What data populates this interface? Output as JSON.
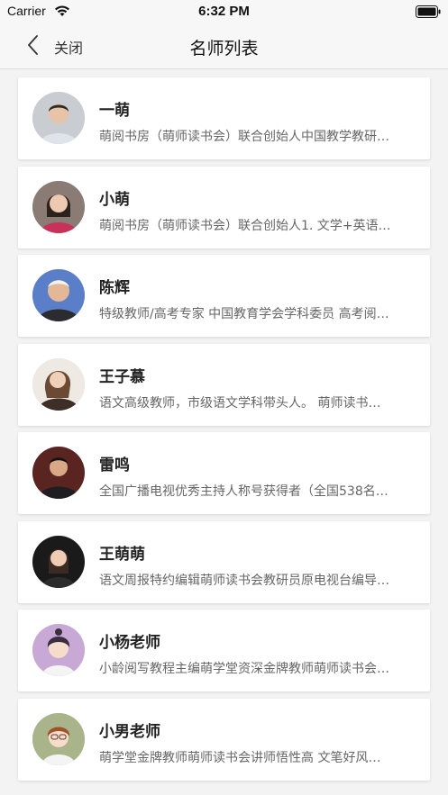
{
  "status_bar": {
    "carrier": "Carrier",
    "time": "6:32 PM"
  },
  "nav": {
    "back_label": "关闭",
    "title": "名师列表"
  },
  "teachers": [
    {
      "name": "一萌",
      "desc": "萌阅书房（萌师读书会）联合创始人中国教学教研…"
    },
    {
      "name": "小萌",
      "desc": "萌阅书房（萌师读书会）联合创始人1. 文学+英语…"
    },
    {
      "name": "陈辉",
      "desc": "特级教师/高考专家 中国教育学会学科委员 高考阅…"
    },
    {
      "name": "王子慕",
      "desc": "语文高级教师，市级语文学科带头人。 萌师读书…"
    },
    {
      "name": "雷鸣",
      "desc": "全国广播电视优秀主持人称号获得者（全国538名…"
    },
    {
      "name": "王萌萌",
      "desc": "语文周报特约编辑萌师读书会教研员原电视台编导…"
    },
    {
      "name": "小杨老师",
      "desc": "小龄阅写教程主编萌学堂资深金牌教师萌师读书会…"
    },
    {
      "name": "小男老师",
      "desc": "萌学堂金牌教师萌师读书会讲师悟性高 文笔好风…"
    }
  ]
}
